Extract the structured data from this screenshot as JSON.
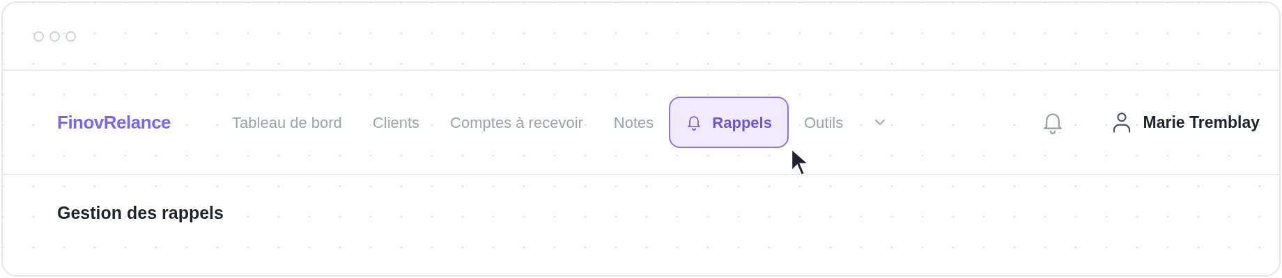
{
  "brand": "FinovRelance",
  "nav": [
    {
      "label": "Tableau de bord",
      "selected": false,
      "kind": "link"
    },
    {
      "label": "Clients",
      "selected": false,
      "kind": "link"
    },
    {
      "label": "Comptes à recevoir",
      "selected": false,
      "kind": "link"
    },
    {
      "label": "Notes",
      "selected": false,
      "kind": "link"
    },
    {
      "label": "Rappels",
      "selected": true,
      "kind": "link"
    },
    {
      "label": "Outils",
      "selected": false,
      "kind": "menu"
    }
  ],
  "user": {
    "name": "Marie Tremblay"
  },
  "page": {
    "title": "Gestion des rappels"
  }
}
